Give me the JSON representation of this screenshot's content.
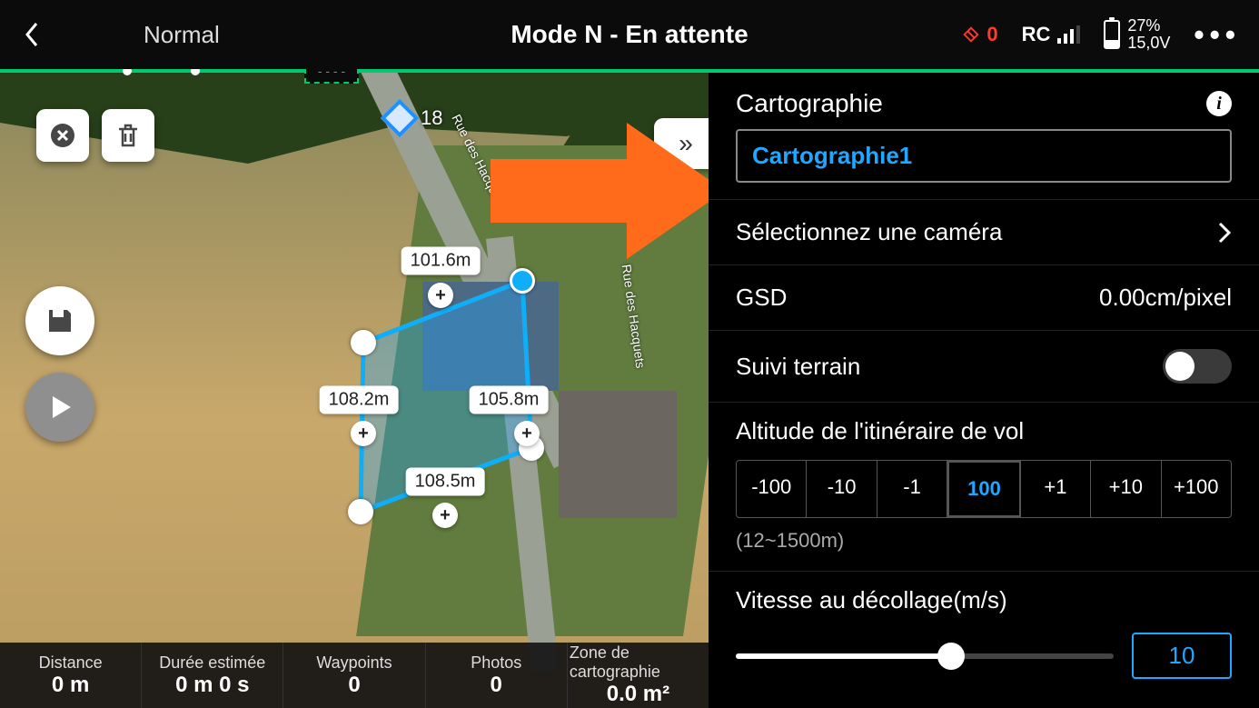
{
  "topbar": {
    "mode_pill": "Normal",
    "title": "Mode N - En attente",
    "satellite_count": "0",
    "rc_label": "RC",
    "battery_percent": "27%",
    "battery_voltage": "15,0V"
  },
  "map": {
    "waypoint_start_number": "18",
    "road_name": "Rue des Hacquets",
    "edges": {
      "top": "101.6m",
      "left": "108.2m",
      "right": "105.8m",
      "bottom": "108.5m"
    }
  },
  "stats": {
    "distance_label": "Distance",
    "distance_value": "0 m",
    "duration_label": "Durée estimée",
    "duration_value": "0 m 0 s",
    "waypoints_label": "Waypoints",
    "waypoints_value": "0",
    "photos_label": "Photos",
    "photos_value": "0",
    "area_label": "Zone de cartographie",
    "area_value": "0.0 m²"
  },
  "panel": {
    "title": "Cartographie",
    "mission_name": "Cartographie1",
    "camera_label": "Sélectionnez une caméra",
    "gsd_label": "GSD",
    "gsd_value": "0.00cm/pixel",
    "terrain_label": "Suivi terrain",
    "terrain_on": false,
    "altitude": {
      "label": "Altitude de l'itinéraire de vol",
      "steps": {
        "m100": "-100",
        "m10": "-10",
        "m1": "-1",
        "value": "100",
        "p1": "+1",
        "p10": "+10",
        "p100": "+100"
      },
      "hint": "(12~1500m)"
    },
    "speed": {
      "label": "Vitesse au décollage(m/s)",
      "value": "10"
    }
  },
  "colors": {
    "accent": "#20a7ff",
    "arrow": "#ff6b1a"
  }
}
